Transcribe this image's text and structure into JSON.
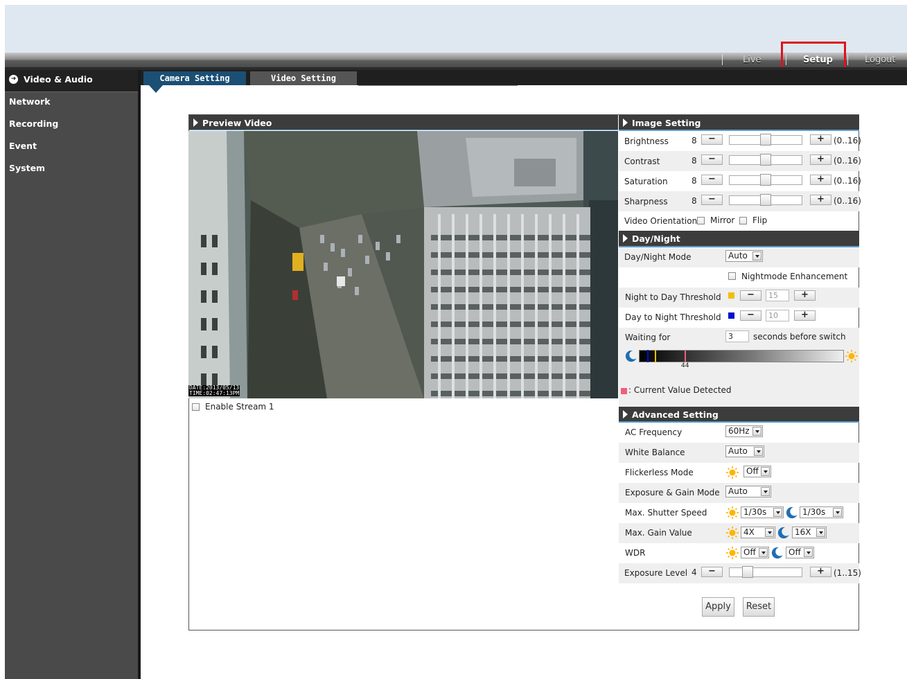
{
  "topnav": {
    "live": "Live",
    "setup": "Setup",
    "logout": "Logout"
  },
  "sidebar": {
    "items": [
      "Video & Audio",
      "Network",
      "Recording",
      "Event",
      "System"
    ]
  },
  "tabs": [
    "Camera Setting",
    "Video Setting"
  ],
  "preview": {
    "title": "Preview Video",
    "timestamp_line1": "DATE:2013/05/13",
    "timestamp_line2": "TIME:02:47:13PM",
    "enable_stream": "Enable Stream 1"
  },
  "image_setting": {
    "title": "Image Setting",
    "rows": [
      {
        "label": "Brightness",
        "value": "8",
        "range": "(0..16)",
        "level": 0.5
      },
      {
        "label": "Contrast",
        "value": "8",
        "range": "(0..16)",
        "level": 0.5
      },
      {
        "label": "Saturation",
        "value": "8",
        "range": "(0..16)",
        "level": 0.5
      },
      {
        "label": "Sharpness",
        "value": "8",
        "range": "(0..16)",
        "level": 0.5
      }
    ],
    "orientation_label": "Video Orientation",
    "mirror": "Mirror",
    "flip": "Flip",
    "minus": "−",
    "plus": "+"
  },
  "day_night": {
    "title": "Day/Night",
    "mode_label": "Day/Night Mode",
    "mode_value": "Auto",
    "enhancement": "Nightmode Enhancement",
    "n2d_label": "Night to Day Threshold",
    "n2d_value": "15",
    "n2d_color": "#f0c000",
    "d2n_label": "Day to Night Threshold",
    "d2n_value": "10",
    "d2n_color": "#0010d0",
    "waiting_label": "Waiting for",
    "waiting_value": "3",
    "waiting_suffix": "seconds before switch",
    "current_value": "44",
    "current_legend": ": Current Value Detected",
    "current_color": "#f0607a"
  },
  "advanced": {
    "title": "Advanced Setting",
    "ac_freq_label": "AC Frequency",
    "ac_freq": "60Hz",
    "wb_label": "White Balance",
    "wb": "Auto",
    "flicker_label": "Flickerless Mode",
    "flicker": "Off",
    "exp_mode_label": "Exposure & Gain Mode",
    "exp_mode": "Auto",
    "shutter_label": "Max. Shutter Speed",
    "shutter_day": "1/30s",
    "shutter_night": "1/30s",
    "gain_label": "Max. Gain Value",
    "gain_day": "4X",
    "gain_night": "16X",
    "wdr_label": "WDR",
    "wdr_day": "Off",
    "wdr_night": "Off",
    "exp_level_label": "Exposure Level",
    "exp_level": "4",
    "exp_range": "(1..15)",
    "exp_level_fraction": 0.21
  },
  "actions": {
    "apply": "Apply",
    "reset": "Reset"
  },
  "colors": {
    "accent_tab": "#1b4f74",
    "sidebar": "#4a4a4a",
    "highlight": "#e0101a",
    "sun": "#ffb400",
    "moon": "#1f6fb2"
  }
}
